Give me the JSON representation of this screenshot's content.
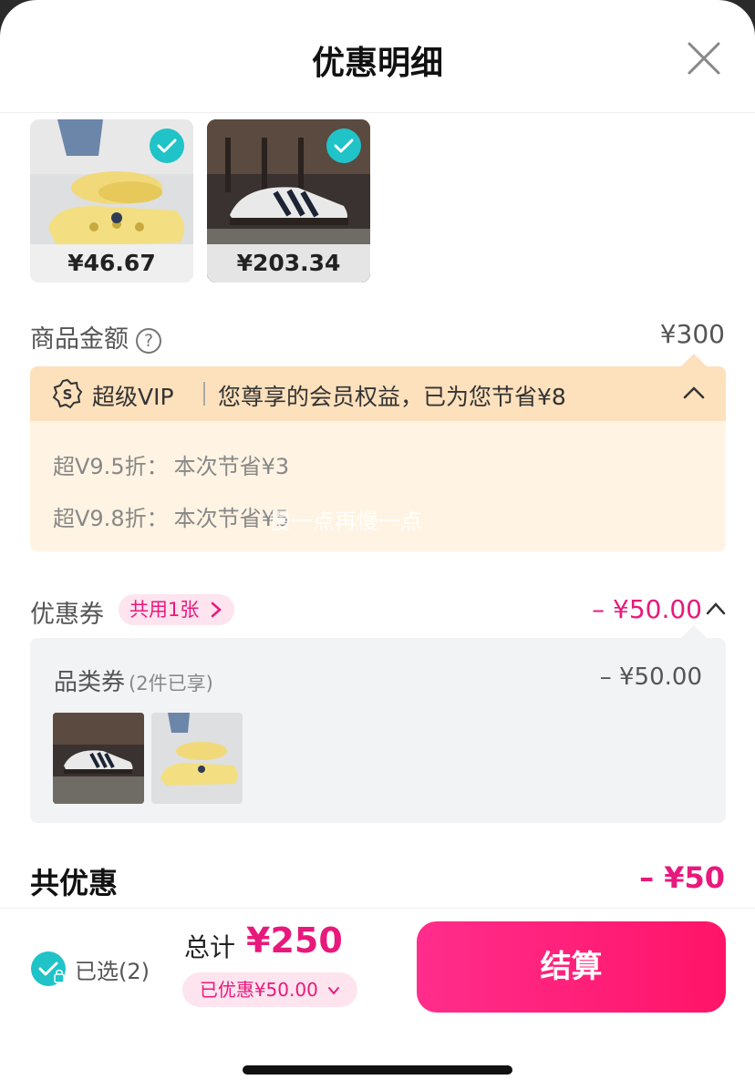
{
  "header": {
    "title": "优惠明细"
  },
  "products": [
    {
      "price": "¥46.67"
    },
    {
      "price": "¥203.34"
    }
  ],
  "goods_amount": {
    "label": "商品金额",
    "help": "?",
    "value": "¥300"
  },
  "vip": {
    "badge": "超级VIP",
    "summary": "您尊享的会员权益，已为您节省¥8",
    "lines": [
      {
        "label": "超V9.5折：",
        "value": "本次节省¥3"
      },
      {
        "label": "超V9.8折：",
        "value": "本次节省¥5"
      }
    ],
    "watermark": "慢一点再慢一点"
  },
  "coupon": {
    "label": "优惠券",
    "chip": "共用1张",
    "value": "– ¥50.00",
    "category": {
      "label": "品类券",
      "note": "(2件已享)",
      "value": "– ¥50.00"
    }
  },
  "total_discount": {
    "label": "共优惠",
    "value": "– ¥50"
  },
  "footer": {
    "selected": "已选(2)",
    "total_label": "总计",
    "total_value": "¥250",
    "discount_pill": "已优惠¥50.00",
    "checkout": "结算"
  },
  "colors": {
    "accent": "#e8197c",
    "check": "#1fc3c8",
    "vip_bg": "#fff4e3"
  }
}
